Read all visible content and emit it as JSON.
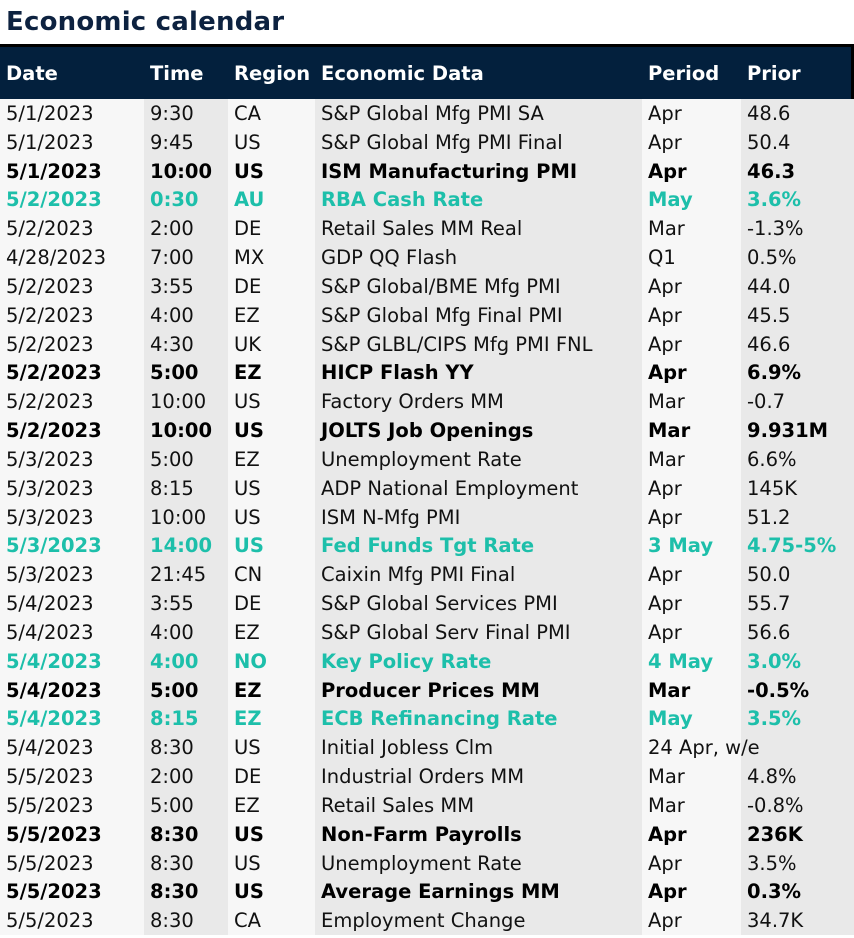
{
  "title": "Economic calendar",
  "colors": {
    "header_bg": "#03203d",
    "highlight": "#1dbfaa",
    "title": "#0d2240"
  },
  "columns": [
    "Date",
    "Time",
    "Region",
    "Economic Data",
    "Period",
    "Prior"
  ],
  "rows": [
    {
      "date": "5/1/2023",
      "time": "9:30",
      "region": "CA",
      "data": "S&P Global Mfg PMI SA",
      "period": "Apr",
      "prior": "48.6",
      "style": "normal"
    },
    {
      "date": "5/1/2023",
      "time": "9:45",
      "region": "US",
      "data": "S&P Global Mfg PMI Final",
      "period": "Apr",
      "prior": "50.4",
      "style": "normal"
    },
    {
      "date": "5/1/2023",
      "time": "10:00",
      "region": "US",
      "data": "ISM Manufacturing PMI",
      "period": "Apr",
      "prior": "46.3",
      "style": "bold"
    },
    {
      "date": "5/2/2023",
      "time": "0:30",
      "region": "AU",
      "data": "RBA Cash Rate",
      "period": "May",
      "prior": "3.6%",
      "style": "teal"
    },
    {
      "date": "5/2/2023",
      "time": "2:00",
      "region": "DE",
      "data": "Retail Sales MM Real",
      "period": "Mar",
      "prior": "-1.3%",
      "style": "normal"
    },
    {
      "date": "4/28/2023",
      "time": "7:00",
      "region": "MX",
      "data": "GDP QQ Flash",
      "period": "Q1",
      "prior": "0.5%",
      "style": "normal"
    },
    {
      "date": "5/2/2023",
      "time": "3:55",
      "region": "DE",
      "data": "S&P Global/BME Mfg PMI",
      "period": "Apr",
      "prior": "44.0",
      "style": "normal"
    },
    {
      "date": "5/2/2023",
      "time": "4:00",
      "region": "EZ",
      "data": "S&P Global Mfg Final PMI",
      "period": "Apr",
      "prior": "45.5",
      "style": "normal"
    },
    {
      "date": "5/2/2023",
      "time": "4:30",
      "region": "UK",
      "data": "S&P GLBL/CIPS Mfg PMI FNL",
      "period": "Apr",
      "prior": "46.6",
      "style": "normal"
    },
    {
      "date": "5/2/2023",
      "time": "5:00",
      "region": "EZ",
      "data": "HICP Flash YY",
      "period": "Apr",
      "prior": "6.9%",
      "style": "bold"
    },
    {
      "date": "5/2/2023",
      "time": "10:00",
      "region": "US",
      "data": "Factory Orders MM",
      "period": "Mar",
      "prior": "-0.7",
      "style": "normal"
    },
    {
      "date": "5/2/2023",
      "time": "10:00",
      "region": "US",
      "data": "JOLTS Job Openings",
      "period": "Mar",
      "prior": "9.931M",
      "style": "bold"
    },
    {
      "date": "5/3/2023",
      "time": "5:00",
      "region": "EZ",
      "data": "Unemployment Rate",
      "period": "Mar",
      "prior": "6.6%",
      "style": "normal"
    },
    {
      "date": "5/3/2023",
      "time": "8:15",
      "region": "US",
      "data": "ADP National Employment",
      "period": "Apr",
      "prior": "145K",
      "style": "normal"
    },
    {
      "date": "5/3/2023",
      "time": "10:00",
      "region": "US",
      "data": "ISM N-Mfg PMI",
      "period": "Apr",
      "prior": "51.2",
      "style": "normal"
    },
    {
      "date": "5/3/2023",
      "time": "14:00",
      "region": "US",
      "data": "Fed Funds Tgt Rate",
      "period": "3 May",
      "prior": "4.75-5%",
      "style": "teal"
    },
    {
      "date": "5/3/2023",
      "time": "21:45",
      "region": "CN",
      "data": "Caixin Mfg PMI Final",
      "period": "Apr",
      "prior": "50.0",
      "style": "normal"
    },
    {
      "date": "5/4/2023",
      "time": "3:55",
      "region": "DE",
      "data": "S&P Global Services PMI",
      "period": "Apr",
      "prior": "55.7",
      "style": "normal"
    },
    {
      "date": "5/4/2023",
      "time": "4:00",
      "region": "EZ",
      "data": "S&P Global Serv Final PMI",
      "period": "Apr",
      "prior": "56.6",
      "style": "normal"
    },
    {
      "date": "5/4/2023",
      "time": "4:00",
      "region": "NO",
      "data": "Key Policy Rate",
      "period": "4 May",
      "prior": "3.0%",
      "style": "teal"
    },
    {
      "date": "5/4/2023",
      "time": "5:00",
      "region": "EZ",
      "data": "Producer Prices MM",
      "period": "Mar",
      "prior": "-0.5%",
      "style": "bold"
    },
    {
      "date": "5/4/2023",
      "time": "8:15",
      "region": "EZ",
      "data": "ECB Refinancing Rate",
      "period": "May",
      "prior": "3.5%",
      "style": "teal"
    },
    {
      "date": "5/4/2023",
      "time": "8:30",
      "region": "US",
      "data": "Initial Jobless Clm",
      "period": "24 Apr, w/e",
      "prior": "",
      "style": "normal"
    },
    {
      "date": "5/5/2023",
      "time": "2:00",
      "region": "DE",
      "data": "Industrial Orders MM",
      "period": "Mar",
      "prior": "4.8%",
      "style": "normal"
    },
    {
      "date": "5/5/2023",
      "time": "5:00",
      "region": "EZ",
      "data": "Retail Sales MM",
      "period": "Mar",
      "prior": "-0.8%",
      "style": "normal"
    },
    {
      "date": "5/5/2023",
      "time": "8:30",
      "region": "US",
      "data": "Non-Farm Payrolls",
      "period": "Apr",
      "prior": "236K",
      "style": "bold"
    },
    {
      "date": "5/5/2023",
      "time": "8:30",
      "region": "US",
      "data": "Unemployment Rate",
      "period": "Apr",
      "prior": "3.5%",
      "style": "normal"
    },
    {
      "date": "5/5/2023",
      "time": "8:30",
      "region": "US",
      "data": "Average Earnings MM",
      "period": "Apr",
      "prior": "0.3%",
      "style": "bold"
    },
    {
      "date": "5/5/2023",
      "time": "8:30",
      "region": "CA",
      "data": "Employment Change",
      "period": "Apr",
      "prior": "34.7K",
      "style": "normal"
    }
  ]
}
